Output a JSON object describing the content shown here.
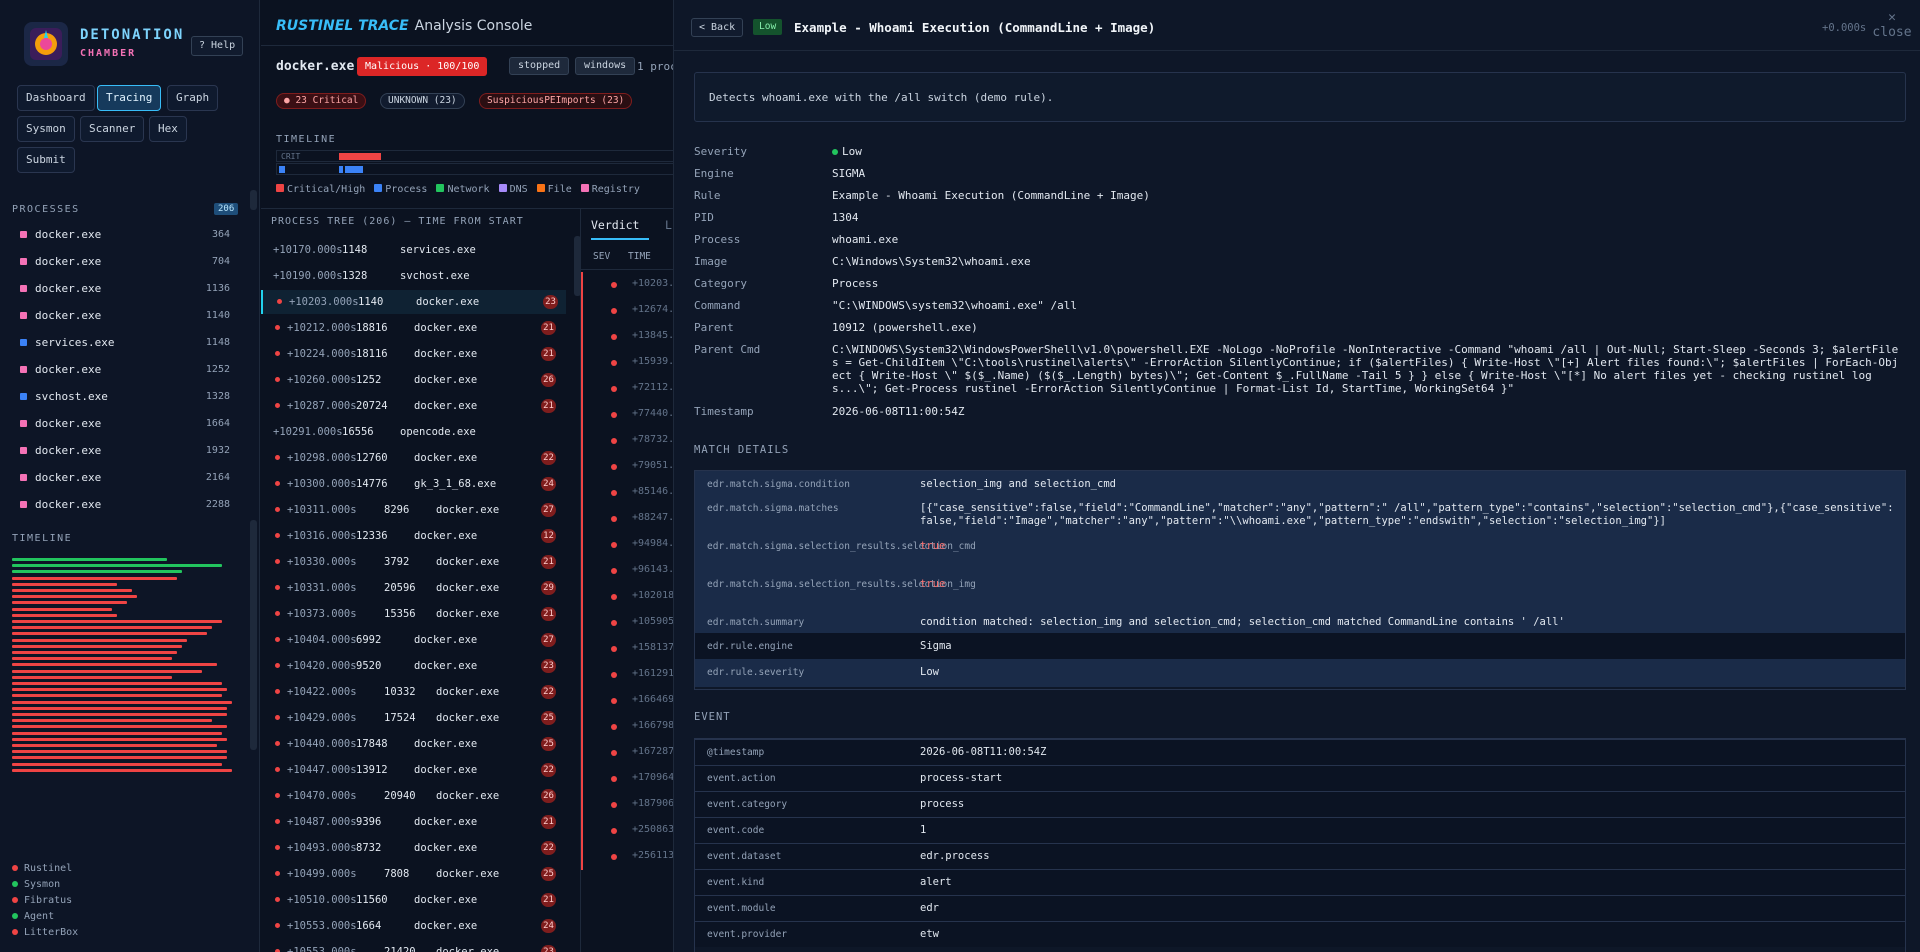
{
  "brand": {
    "name": "DETONATION",
    "sub": "CHAMBER",
    "help": "? Help"
  },
  "nav": [
    "Dashboard",
    "Tracing",
    "Graph",
    "Sysmon",
    "Scanner",
    "Hex",
    "Submit"
  ],
  "processes": {
    "label": "PROCESSES",
    "count": "206",
    "items": [
      {
        "name": "docker.exe",
        "pid": "364",
        "color": "#f472b6"
      },
      {
        "name": "docker.exe",
        "pid": "704",
        "color": "#f472b6"
      },
      {
        "name": "docker.exe",
        "pid": "1136",
        "color": "#f472b6"
      },
      {
        "name": "docker.exe",
        "pid": "1140",
        "color": "#f472b6"
      },
      {
        "name": "services.exe",
        "pid": "1148",
        "color": "#3b82f6"
      },
      {
        "name": "docker.exe",
        "pid": "1252",
        "color": "#f472b6"
      },
      {
        "name": "svchost.exe",
        "pid": "1328",
        "color": "#3b82f6"
      },
      {
        "name": "docker.exe",
        "pid": "1664",
        "color": "#f472b6"
      },
      {
        "name": "docker.exe",
        "pid": "1932",
        "color": "#f472b6"
      },
      {
        "name": "docker.exe",
        "pid": "2164",
        "color": "#f472b6"
      },
      {
        "name": "docker.exe",
        "pid": "2288",
        "color": "#f472b6"
      }
    ]
  },
  "timeline_label": "TIMELINE",
  "sources": [
    {
      "name": "Rustinel",
      "color": "#ef4444"
    },
    {
      "name": "Sysmon",
      "color": "#22c55e"
    },
    {
      "name": "Fibratus",
      "color": "#ef4444"
    },
    {
      "name": "Agent",
      "color": "#22c55e"
    },
    {
      "name": "LitterBox",
      "color": "#ef4444"
    }
  ],
  "console": {
    "brand": "RUSTINEL TRACE",
    "title": "Analysis Console",
    "proc": "docker.exe",
    "verdict": "Malicious · 100/100",
    "tags": [
      "stopped",
      "windows"
    ],
    "procs": "1 proc",
    "pills": [
      "● 23 Critical",
      "UNKNOWN (23)",
      "SuspiciousPEImports (23)"
    ],
    "tl_label": "TIMELINE",
    "tl_crit": "CRIT",
    "legend": [
      "Critical/High",
      "Process",
      "Network",
      "DNS",
      "File",
      "Registry"
    ],
    "legend_colors": [
      "#ef4444",
      "#3b82f6",
      "#22c55e",
      "#a78bfa",
      "#f97316",
      "#f472b6"
    ],
    "tree_header": "PROCESS TREE (206) — TIME FROM START",
    "tree": [
      {
        "t": "+10170.000s",
        "p": "1148",
        "n": "services.exe",
        "c": "",
        "d": 0,
        "crit": false
      },
      {
        "t": "+10190.000s",
        "p": "1328",
        "n": "svchost.exe",
        "c": "",
        "d": 0,
        "crit": false
      },
      {
        "t": "+10203.000s",
        "p": "1140",
        "n": "docker.exe",
        "c": "23",
        "d": 0,
        "crit": true
      },
      {
        "t": "+10212.000s",
        "p": "18816",
        "n": "docker.exe",
        "c": "21",
        "d": 0,
        "crit": true
      },
      {
        "t": "+10224.000s",
        "p": "18116",
        "n": "docker.exe",
        "c": "21",
        "d": 0,
        "crit": true
      },
      {
        "t": "+10260.000s",
        "p": "1252",
        "n": "docker.exe",
        "c": "26",
        "d": 0,
        "crit": true
      },
      {
        "t": "+10287.000s",
        "p": "20724",
        "n": "docker.exe",
        "c": "21",
        "d": 0,
        "crit": true
      },
      {
        "t": "+10291.000s",
        "p": "16556",
        "n": "opencode.exe",
        "c": "",
        "d": 0,
        "crit": false
      },
      {
        "t": "+10298.000s",
        "p": "12760",
        "n": "docker.exe",
        "c": "22",
        "d": 0,
        "crit": true
      },
      {
        "t": "+10300.000s",
        "p": "14776",
        "n": "gk_3_1_68.exe",
        "c": "24",
        "d": 0,
        "crit": true
      },
      {
        "t": "+10311.000s",
        "p": "8296",
        "n": "docker.exe",
        "c": "27",
        "d": 1,
        "crit": true
      },
      {
        "t": "+10316.000s",
        "p": "12336",
        "n": "docker.exe",
        "c": "12",
        "d": 0,
        "crit": true
      },
      {
        "t": "+10330.000s",
        "p": "3792",
        "n": "docker.exe",
        "c": "21",
        "d": 1,
        "crit": true
      },
      {
        "t": "+10331.000s",
        "p": "20596",
        "n": "docker.exe",
        "c": "29",
        "d": 1,
        "crit": true
      },
      {
        "t": "+10373.000s",
        "p": "15356",
        "n": "docker.exe",
        "c": "21",
        "d": 1,
        "crit": true
      },
      {
        "t": "+10404.000s",
        "p": "6992",
        "n": "docker.exe",
        "c": "27",
        "d": 0,
        "crit": true
      },
      {
        "t": "+10420.000s",
        "p": "9520",
        "n": "docker.exe",
        "c": "23",
        "d": 0,
        "crit": true
      },
      {
        "t": "+10422.000s",
        "p": "10332",
        "n": "docker.exe",
        "c": "22",
        "d": 1,
        "crit": true
      },
      {
        "t": "+10429.000s",
        "p": "17524",
        "n": "docker.exe",
        "c": "25",
        "d": 1,
        "crit": true
      },
      {
        "t": "+10440.000s",
        "p": "17848",
        "n": "docker.exe",
        "c": "25",
        "d": 0,
        "crit": true
      },
      {
        "t": "+10447.000s",
        "p": "13912",
        "n": "docker.exe",
        "c": "22",
        "d": 0,
        "crit": true
      },
      {
        "t": "+10470.000s",
        "p": "20940",
        "n": "docker.exe",
        "c": "26",
        "d": 1,
        "crit": true
      },
      {
        "t": "+10487.000s",
        "p": "9396",
        "n": "docker.exe",
        "c": "21",
        "d": 0,
        "crit": true
      },
      {
        "t": "+10493.000s",
        "p": "8732",
        "n": "docker.exe",
        "c": "22",
        "d": 0,
        "crit": true
      },
      {
        "t": "+10499.000s",
        "p": "7808",
        "n": "docker.exe",
        "c": "25",
        "d": 1,
        "crit": true
      },
      {
        "t": "+10510.000s",
        "p": "11560",
        "n": "docker.exe",
        "c": "21",
        "d": 0,
        "crit": true
      },
      {
        "t": "+10553.000s",
        "p": "1664",
        "n": "docker.exe",
        "c": "24",
        "d": 0,
        "crit": true
      },
      {
        "t": "+10553.000s",
        "p": "21420",
        "n": "docker.exe",
        "c": "23",
        "d": 1,
        "crit": true
      }
    ]
  },
  "verdict_tab": "Verdict",
  "vcols": [
    "SEV",
    "TIME"
  ],
  "vtimes": [
    "+10203.0",
    "+12674.0",
    "+13845.0",
    "+15939.0",
    "+72112.0",
    "+77440.0",
    "+78732.0",
    "+79051.0",
    "+85146.0",
    "+88247.0",
    "+94984.0",
    "+96143.0",
    "+102018.",
    "+105905.",
    "+158137.",
    "+161291.",
    "+166469.",
    "+166798.",
    "+167287.",
    "+170964.",
    "+187906.",
    "+250863.",
    "+256113."
  ],
  "detail": {
    "back": "< Back",
    "sev": "Low",
    "title": "Example - Whoami Execution (CommandLine + Image)",
    "time": "+0.000s",
    "close": "close",
    "close_icon": "✕",
    "desc": "Detects whoami.exe with the /all switch (demo rule).",
    "fields": [
      {
        "k": "Severity",
        "v": "Low"
      },
      {
        "k": "Engine",
        "v": "SIGMA"
      },
      {
        "k": "Rule",
        "v": "Example - Whoami Execution (CommandLine + Image)"
      },
      {
        "k": "PID",
        "v": "1304"
      },
      {
        "k": "Process",
        "v": "whoami.exe"
      },
      {
        "k": "Image",
        "v": "C:\\Windows\\System32\\whoami.exe"
      },
      {
        "k": "Category",
        "v": "Process"
      },
      {
        "k": "Command",
        "v": "\"C:\\WINDOWS\\system32\\whoami.exe\" /all"
      },
      {
        "k": "Parent",
        "v": "10912 (powershell.exe)"
      },
      {
        "k": "Parent Cmd",
        "v": "C:\\WINDOWS\\System32\\WindowsPowerShell\\v1.0\\powershell.EXE -NoLogo -NoProfile -NonInteractive -Command \"whoami /all | Out-Null; Start-Sleep -Seconds 3; $alertFiles = Get-ChildItem \\\"C:\\tools\\rustinel\\alerts\\\" -ErrorAction SilentlyContinue; if ($alertFiles) { Write-Host \\\"[+] Alert files found:\\\"; $alertFiles | ForEach-Object { Write-Host \\\" $($_.Name) ($($_.Length) bytes)\\\"; Get-Content $_.FullName -Tail 5 } } else { Write-Host \\\"[*] No alert files yet - checking rustinel logs...\\\"; Get-Process rustinel -ErrorAction SilentlyContinue | Format-List Id, StartTime, WorkingSet64 }\""
      },
      {
        "k": "Timestamp",
        "v": "2026-06-08T11:00:54Z"
      }
    ],
    "match_label": "MATCH DETAILS",
    "match": [
      {
        "k": "edr.match.sigma.condition",
        "v": "selection_img and selection_cmd",
        "red": false
      },
      {
        "k": "edr.match.sigma.matches",
        "v": "[{\"case_sensitive\":false,\"field\":\"CommandLine\",\"matcher\":\"any\",\"pattern\":\" /all\",\"pattern_type\":\"contains\",\"selection\":\"selection_cmd\"},{\"case_sensitive\":false,\"field\":\"Image\",\"matcher\":\"any\",\"pattern\":\"\\\\whoami.exe\",\"pattern_type\":\"endswith\",\"selection\":\"selection_img\"}]",
        "red": false
      },
      {
        "k": "edr.match.sigma.selection_results.selection_cmd",
        "v": "true",
        "red": true
      },
      {
        "k": "edr.match.sigma.selection_results.selection_img",
        "v": "true",
        "red": true
      },
      {
        "k": "edr.match.summary",
        "v": "condition matched: selection_img and selection_cmd; selection_cmd matched CommandLine contains ' /all'",
        "red": false
      },
      {
        "k": "edr.rule.engine",
        "v": "Sigma",
        "red": false
      },
      {
        "k": "edr.rule.severity",
        "v": "Low",
        "red": false
      }
    ],
    "event_label": "EVENT",
    "event": [
      {
        "k": "@timestamp",
        "v": "2026-06-08T11:00:54Z"
      },
      {
        "k": "event.action",
        "v": "process-start"
      },
      {
        "k": "event.category",
        "v": "process"
      },
      {
        "k": "event.code",
        "v": "1"
      },
      {
        "k": "event.dataset",
        "v": "edr.process"
      },
      {
        "k": "event.kind",
        "v": "alert"
      },
      {
        "k": "event.module",
        "v": "edr"
      },
      {
        "k": "event.provider",
        "v": "etw"
      }
    ]
  }
}
